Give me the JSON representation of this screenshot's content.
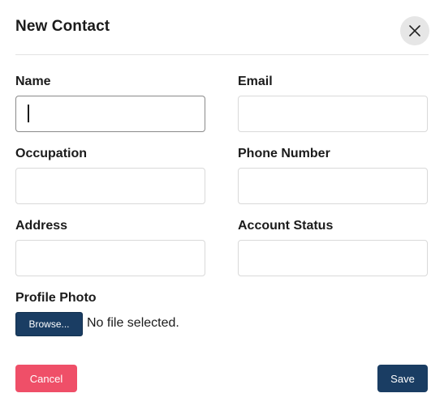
{
  "dialog": {
    "title": "New Contact",
    "close_icon": "close-icon"
  },
  "form": {
    "name": {
      "label": "Name",
      "value": ""
    },
    "email": {
      "label": "Email",
      "value": ""
    },
    "occupation": {
      "label": "Occupation",
      "value": ""
    },
    "phone": {
      "label": "Phone Number",
      "value": ""
    },
    "address": {
      "label": "Address",
      "value": ""
    },
    "account_status": {
      "label": "Account Status",
      "value": ""
    },
    "profile_photo": {
      "label": "Profile Photo",
      "browse_label": "Browse...",
      "file_status": "No file selected."
    }
  },
  "actions": {
    "cancel_label": "Cancel",
    "save_label": "Save"
  },
  "colors": {
    "primary": "#1a3d63",
    "danger": "#ef4f68"
  }
}
